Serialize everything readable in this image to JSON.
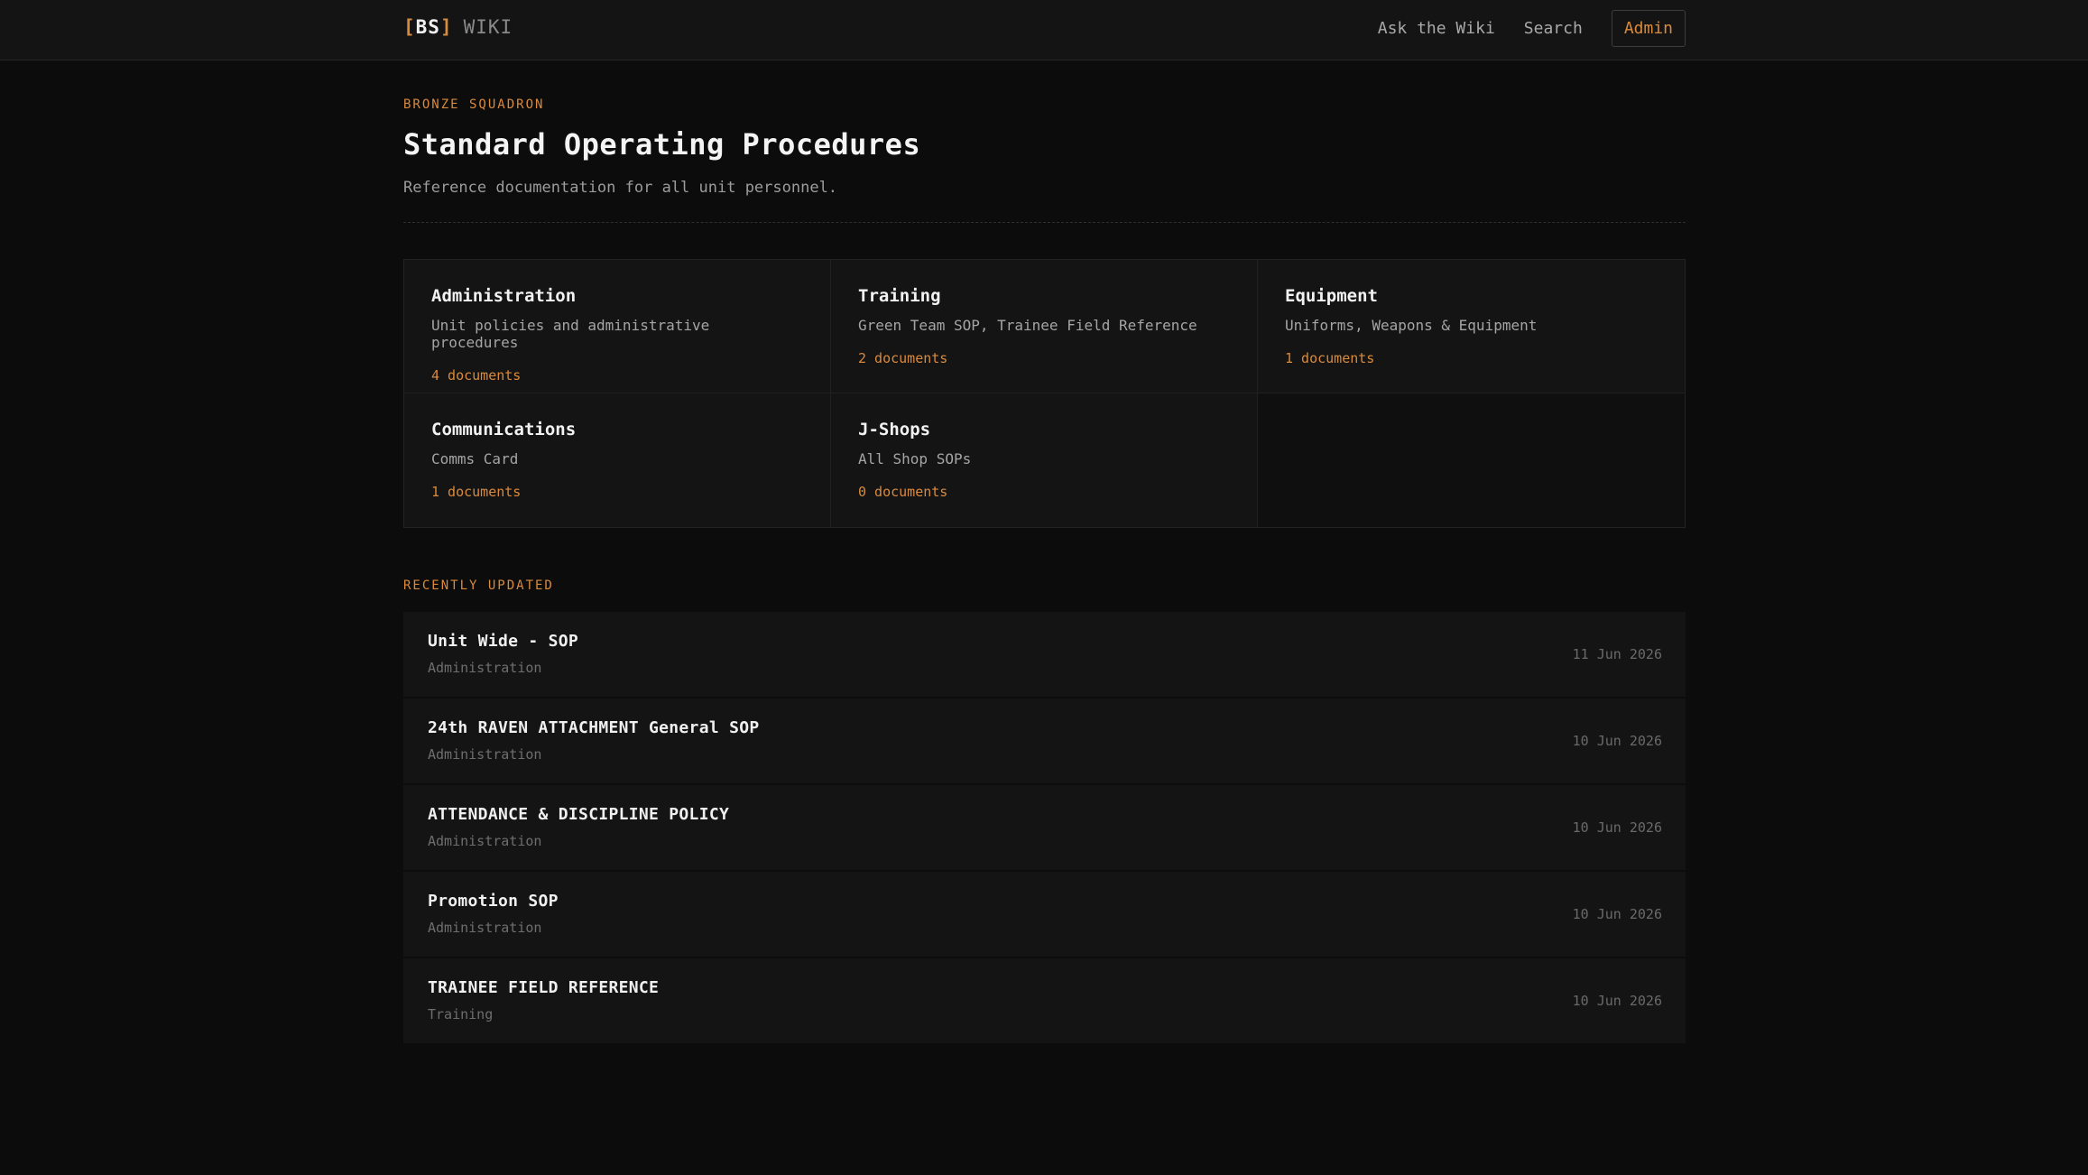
{
  "header": {
    "brand_bracket_open": "[",
    "brand_bs": "BS",
    "brand_bracket_close": "]",
    "brand_wiki": "WIKI",
    "nav": {
      "ask": "Ask the Wiki",
      "search": "Search",
      "admin": "Admin"
    }
  },
  "hero": {
    "eyebrow": "BRONZE SQUADRON",
    "title": "Standard Operating Procedures",
    "subtitle": "Reference documentation for all unit personnel."
  },
  "categories": [
    {
      "title": "Administration",
      "desc": "Unit policies and administrative procedures",
      "count": "4 documents"
    },
    {
      "title": "Training",
      "desc": "Green Team SOP, Trainee Field Reference",
      "count": "2 documents"
    },
    {
      "title": "Equipment",
      "desc": "Uniforms, Weapons & Equipment",
      "count": "1 documents"
    },
    {
      "title": "Communications",
      "desc": "Comms Card",
      "count": "1 documents"
    },
    {
      "title": "J-Shops",
      "desc": "All Shop SOPs",
      "count": "0 documents"
    }
  ],
  "recent": {
    "label": "RECENTLY UPDATED",
    "items": [
      {
        "title": "Unit Wide - SOP",
        "category": "Administration",
        "date": "11 Jun 2026"
      },
      {
        "title": "24th RAVEN ATTACHMENT General SOP",
        "category": "Administration",
        "date": "10 Jun 2026"
      },
      {
        "title": "ATTENDANCE & DISCIPLINE POLICY",
        "category": "Administration",
        "date": "10 Jun 2026"
      },
      {
        "title": "Promotion SOP",
        "category": "Administration",
        "date": "10 Jun 2026"
      },
      {
        "title": "TRAINEE FIELD REFERENCE",
        "category": "Training",
        "date": "10 Jun 2026"
      }
    ]
  },
  "colors": {
    "accent": "#d98a3d",
    "background": "#0c0c0c",
    "surface": "#141415"
  }
}
